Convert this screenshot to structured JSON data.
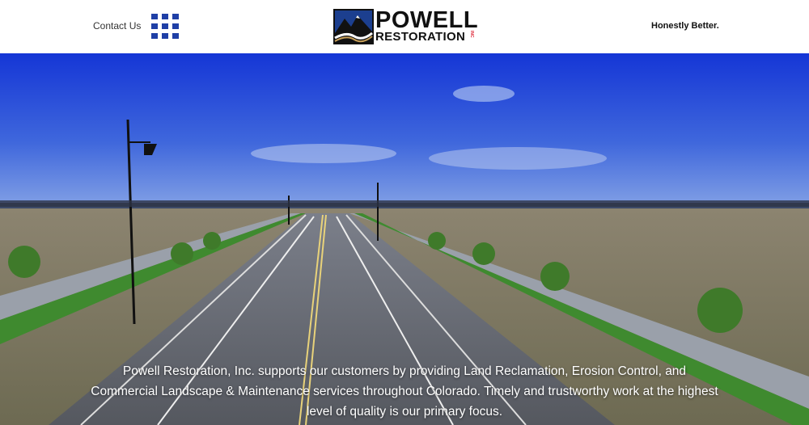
{
  "header": {
    "contact_label": "Contact Us",
    "menu_icon": "grid-menu-icon",
    "logo": {
      "name": "POWELL",
      "subname": "RESTORATION",
      "suffix": "INC"
    },
    "tagline": "Honestly Better."
  },
  "hero": {
    "description": "Powell Restoration, Inc. supports our customers by providing Land Reclamation, Erosion Control, and Commercial Landscape & Maintenance services throughout Colorado. Timely and trustworthy work at the highest level of quality is our primary focus."
  },
  "colors": {
    "brand_blue": "#1f3fa6",
    "sky_top": "#1536d6",
    "sky_bottom": "#8aa7e6"
  }
}
